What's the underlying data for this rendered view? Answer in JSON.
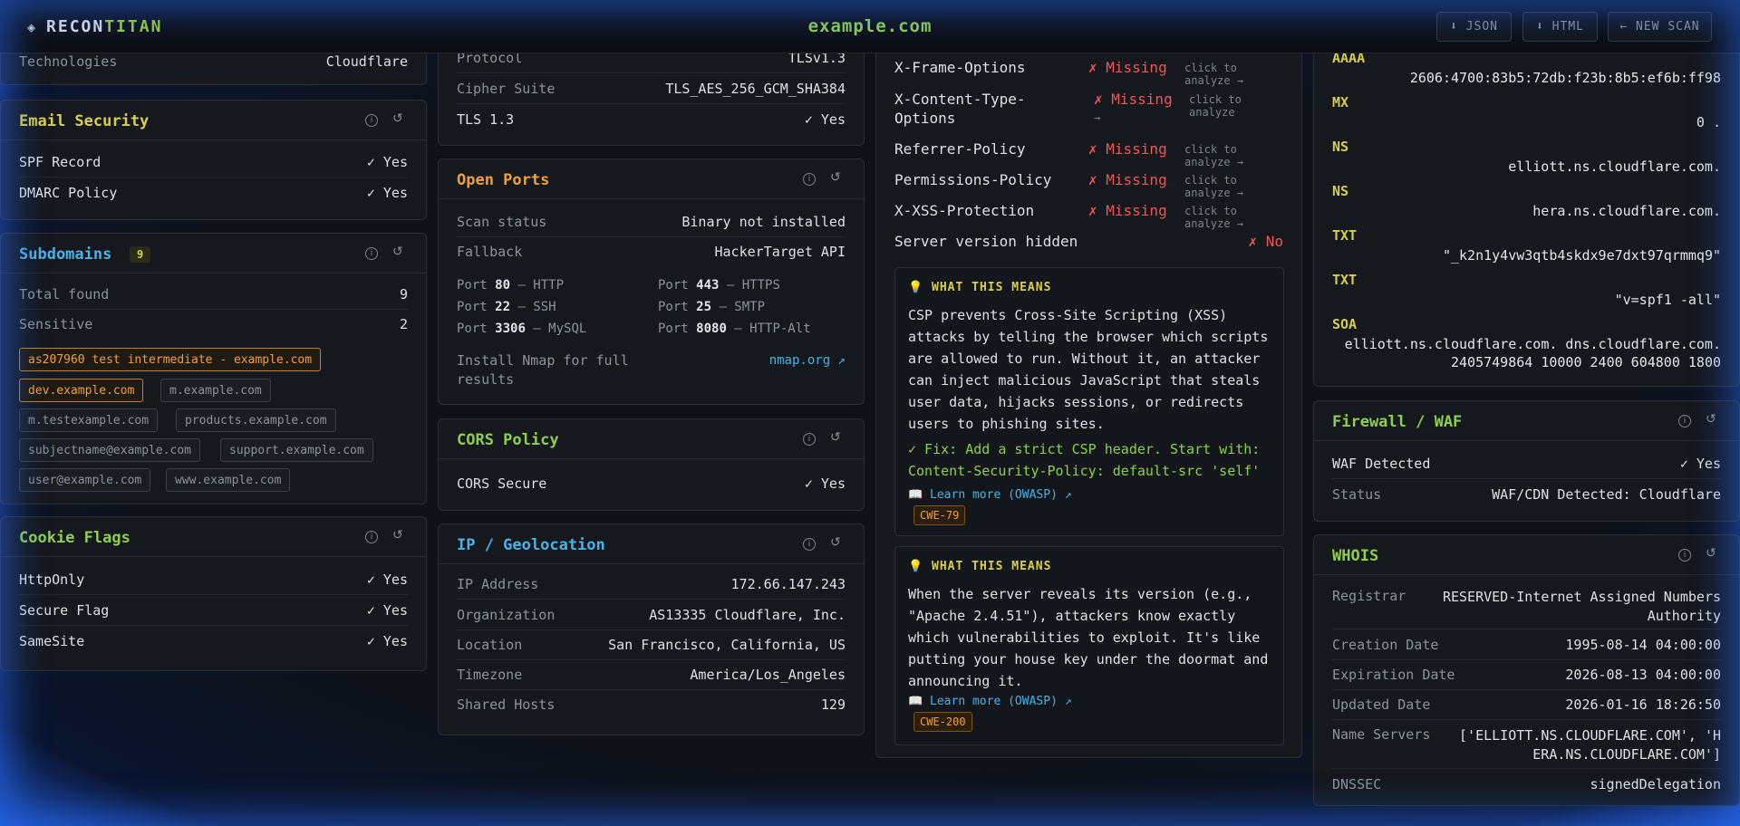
{
  "header": {
    "brand_a": "RECON",
    "brand_b": "TITAN",
    "domain": "example.com",
    "btn_json": "⬇ JSON",
    "btn_html": "⬇ HTML",
    "btn_new": "← NEW SCAN"
  },
  "col1": {
    "tech": {
      "label": "Technologies",
      "value": "Cloudflare"
    },
    "email": {
      "title": "Email Security",
      "rows": [
        {
          "label": "SPF Record",
          "value": "✓ Yes"
        },
        {
          "label": "DMARC Policy",
          "value": "✓ Yes"
        }
      ]
    },
    "subdomains": {
      "title": "Subdomains",
      "count": "9",
      "total_label": "Total found",
      "total_value": "9",
      "sensitive_label": "Sensitive",
      "sensitive_value": "2",
      "chips": [
        "as207960 test intermediate - example.com",
        "dev.example.com",
        "m.example.com",
        "m.testexample.com",
        "products.example.com",
        "subjectname@example.com",
        "support.example.com",
        "user@example.com",
        "www.example.com"
      ]
    },
    "cookies": {
      "title": "Cookie Flags",
      "rows": [
        {
          "label": "HttpOnly",
          "value": "✓ Yes"
        },
        {
          "label": "Secure Flag",
          "value": "✓ Yes"
        },
        {
          "label": "SameSite",
          "value": "✓ Yes"
        }
      ]
    }
  },
  "col2": {
    "ssl": {
      "protocol_label": "Protocol",
      "protocol_value": "TLSv1.3",
      "cipher_label": "Cipher Suite",
      "cipher_value": "TLS_AES_256_GCM_SHA384",
      "tls_label": "TLS 1.3",
      "tls_value": "✓ Yes"
    },
    "ports": {
      "title": "Open Ports",
      "status_label": "Scan status",
      "status_value": "Binary not installed",
      "fallback_label": "Fallback",
      "fallback_value": "HackerTarget API",
      "list": [
        {
          "pre": "Port ",
          "num": "80",
          "svc": " — HTTP"
        },
        {
          "pre": "Port ",
          "num": "443",
          "svc": " — HTTPS"
        },
        {
          "pre": "Port ",
          "num": "22",
          "svc": " — SSH"
        },
        {
          "pre": "Port ",
          "num": "25",
          "svc": " — SMTP"
        },
        {
          "pre": "Port ",
          "num": "3306",
          "svc": " — MySQL"
        },
        {
          "pre": "Port ",
          "num": "8080",
          "svc": " — HTTP-Alt"
        }
      ],
      "install_line1": "Install Nmap for full",
      "install_line2": "results",
      "nmap_link": "nmap.org ↗"
    },
    "cors": {
      "title": "CORS Policy",
      "label": "CORS Secure",
      "value": "✓ Yes"
    },
    "geo": {
      "title": "IP / Geolocation",
      "rows": [
        {
          "label": "IP Address",
          "value": "172.66.147.243"
        },
        {
          "label": "Organization",
          "value": "AS13335 Cloudflare, Inc."
        },
        {
          "label": "Location",
          "value": "San Francisco, California, US"
        },
        {
          "label": "Timezone",
          "value": "America/Los_Angeles"
        },
        {
          "label": "Shared Hosts",
          "value": "129"
        }
      ]
    }
  },
  "col3": {
    "headers": [
      {
        "label": "X-Frame-Options",
        "status": "✗ Missing",
        "action": "click to analyze →"
      },
      {
        "label": "X-Content-Type-",
        "label2": "Options",
        "status": "✗ Missing",
        "action": "click to analyze",
        "action2": "→"
      },
      {
        "label": "Referrer-Policy",
        "status": "✗ Missing",
        "action": "click to analyze →"
      },
      {
        "label": "Permissions-Policy",
        "status": "✗ Missing",
        "action": "click to analyze →"
      },
      {
        "label": "X-XSS-Protection",
        "status": "✗ Missing",
        "action": "click to analyze →"
      }
    ],
    "server_label": "Server version hidden",
    "server_value": "✗ No",
    "explain1": {
      "title": "💡 WHAT THIS MEANS",
      "lines": [
        "CSP prevents Cross-Site Scripting (XSS)",
        "attacks by telling the browser which scripts",
        "are allowed to run. Without it, an attacker",
        "can inject malicious JavaScript that steals",
        "user data, hijacks sessions, or redirects",
        "users to phishing sites."
      ],
      "fix1": "✓ Fix: Add a strict CSP header. Start with:",
      "fix2": "Content-Security-Policy: default-src 'self'",
      "link": "📖 Learn more (OWASP) ↗",
      "cwe": "CWE-79"
    },
    "explain2": {
      "title": "💡 WHAT THIS MEANS",
      "lines": [
        "When the server reveals its version (e.g.,",
        "\"Apache 2.4.51\"), attackers know exactly",
        "which vulnerabilities to exploit. It's like",
        "putting your house key under the doormat and",
        "announcing it."
      ],
      "link": "📖 Learn more (OWASP) ↗",
      "cwe": "CWE-200"
    }
  },
  "col4": {
    "dns": [
      {
        "type": "AAAA",
        "value": "2606:4700:83b5:72db:f23b:8b5:ef6b:ff98"
      },
      {
        "type": "MX",
        "value": "0 ."
      },
      {
        "type": "NS",
        "value": "elliott.ns.cloudflare.com."
      },
      {
        "type": "NS",
        "value": "hera.ns.cloudflare.com."
      },
      {
        "type": "TXT",
        "value": "\"_k2n1y4vw3qtb4skdx9e7dxt97qrmmq9\""
      },
      {
        "type": "TXT",
        "value": "\"v=spf1 -all\""
      },
      {
        "type": "SOA",
        "value": "elliott.ns.cloudflare.com. dns.cloudflare.com.",
        "value2": "2405749864 10000 2400 604800 1800"
      }
    ],
    "waf": {
      "title": "Firewall / WAF",
      "detected_label": "WAF Detected",
      "detected_value": "✓ Yes",
      "status_label": "Status",
      "status_value": "WAF/CDN Detected: Cloudflare"
    },
    "whois": {
      "title": "WHOIS",
      "registrar_label": "Registrar",
      "registrar_value1": "RESERVED-Internet Assigned Numbers",
      "registrar_value2": "Authority",
      "rows": [
        {
          "label": "Creation Date",
          "value": "1995-08-14 04:00:00"
        },
        {
          "label": "Expiration Date",
          "value": "2026-08-13 04:00:00"
        },
        {
          "label": "Updated Date",
          "value": "2026-01-16 18:26:50"
        }
      ],
      "ns_label": "Name Servers",
      "ns_value1": "['ELLIOTT.NS.CLOUDFLARE.COM', 'H",
      "ns_value2": "ERA.NS.CLOUDFLARE.COM']",
      "dnssec_label": "DNSSEC",
      "dnssec_value": "signedDelegation"
    }
  }
}
